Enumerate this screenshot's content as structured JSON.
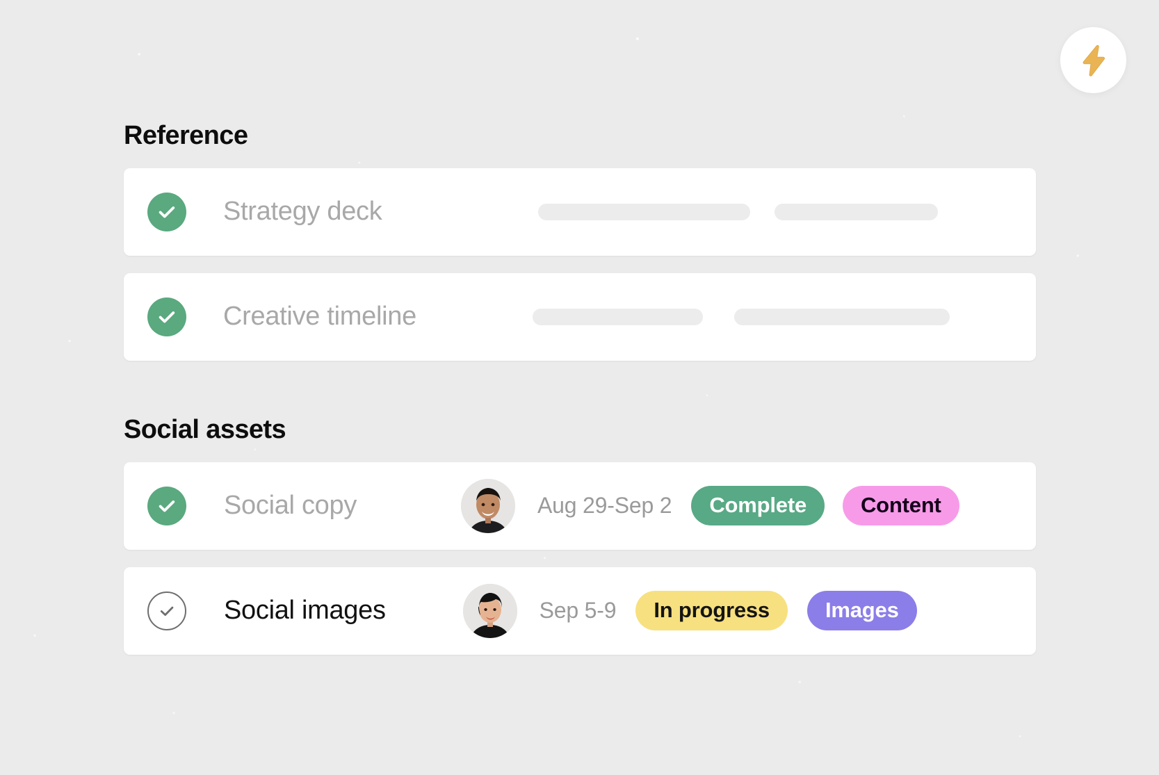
{
  "app": {
    "background_color": "#ebebeb",
    "card_color": "#ffffff"
  },
  "quick_action": {
    "name": "bolt-button",
    "icon": "lightning-bolt-icon",
    "color": "#eab455"
  },
  "sections": [
    {
      "id": "reference",
      "title": "Reference",
      "rows": [
        {
          "id": "strategy-deck",
          "name": "Strategy deck",
          "completed": true,
          "check_icon": "check-circle-filled-icon",
          "placeholders": [
            305,
            235
          ]
        },
        {
          "id": "creative-timeline",
          "name": "Creative timeline",
          "completed": true,
          "check_icon": "check-circle-filled-icon",
          "placeholders": [
            245,
            310
          ]
        }
      ]
    },
    {
      "id": "social-assets",
      "title": "Social assets",
      "rows": [
        {
          "id": "social-copy",
          "name": "Social copy",
          "completed": true,
          "check_icon": "check-circle-filled-icon",
          "avatar": "avatar-male",
          "date": "Aug 29-Sep 2",
          "badges": [
            {
              "label": "Complete",
              "style": "green",
              "bg": "#58a985",
              "fg": "#ffffff"
            },
            {
              "label": "Content",
              "style": "pink",
              "bg": "#f79be8",
              "fg": "#14001a"
            }
          ]
        },
        {
          "id": "social-images",
          "name": "Social images",
          "completed": false,
          "check_icon": "check-circle-outline-icon",
          "avatar": "avatar-female",
          "date": "Sep 5-9",
          "badges": [
            {
              "label": "In progress",
              "style": "yellow",
              "bg": "#f7e07f",
              "fg": "#141414"
            },
            {
              "label": "Images",
              "style": "purple",
              "bg": "#8b7ee8",
              "fg": "#ffffff"
            }
          ]
        }
      ]
    }
  ]
}
